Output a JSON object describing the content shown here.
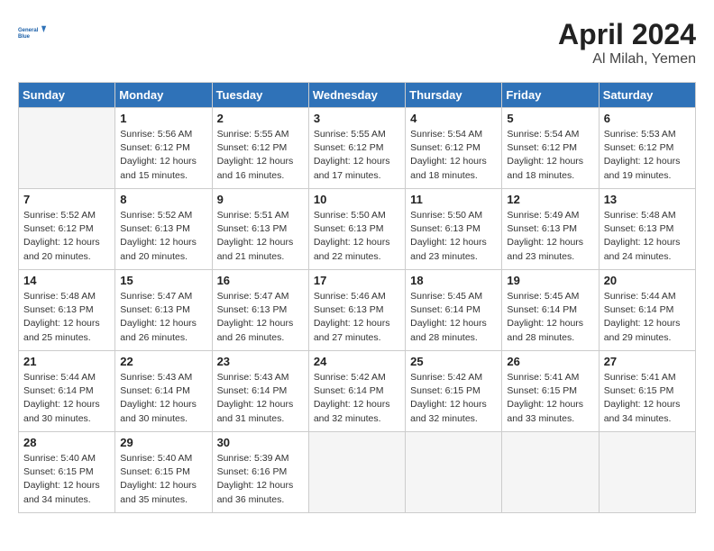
{
  "header": {
    "logo_line1": "General",
    "logo_line2": "Blue",
    "month_year": "April 2024",
    "location": "Al Milah, Yemen"
  },
  "weekdays": [
    "Sunday",
    "Monday",
    "Tuesday",
    "Wednesday",
    "Thursday",
    "Friday",
    "Saturday"
  ],
  "weeks": [
    [
      {
        "day": "",
        "info": ""
      },
      {
        "day": "1",
        "info": "Sunrise: 5:56 AM\nSunset: 6:12 PM\nDaylight: 12 hours\nand 15 minutes."
      },
      {
        "day": "2",
        "info": "Sunrise: 5:55 AM\nSunset: 6:12 PM\nDaylight: 12 hours\nand 16 minutes."
      },
      {
        "day": "3",
        "info": "Sunrise: 5:55 AM\nSunset: 6:12 PM\nDaylight: 12 hours\nand 17 minutes."
      },
      {
        "day": "4",
        "info": "Sunrise: 5:54 AM\nSunset: 6:12 PM\nDaylight: 12 hours\nand 18 minutes."
      },
      {
        "day": "5",
        "info": "Sunrise: 5:54 AM\nSunset: 6:12 PM\nDaylight: 12 hours\nand 18 minutes."
      },
      {
        "day": "6",
        "info": "Sunrise: 5:53 AM\nSunset: 6:12 PM\nDaylight: 12 hours\nand 19 minutes."
      }
    ],
    [
      {
        "day": "7",
        "info": "Sunrise: 5:52 AM\nSunset: 6:12 PM\nDaylight: 12 hours\nand 20 minutes."
      },
      {
        "day": "8",
        "info": "Sunrise: 5:52 AM\nSunset: 6:13 PM\nDaylight: 12 hours\nand 20 minutes."
      },
      {
        "day": "9",
        "info": "Sunrise: 5:51 AM\nSunset: 6:13 PM\nDaylight: 12 hours\nand 21 minutes."
      },
      {
        "day": "10",
        "info": "Sunrise: 5:50 AM\nSunset: 6:13 PM\nDaylight: 12 hours\nand 22 minutes."
      },
      {
        "day": "11",
        "info": "Sunrise: 5:50 AM\nSunset: 6:13 PM\nDaylight: 12 hours\nand 23 minutes."
      },
      {
        "day": "12",
        "info": "Sunrise: 5:49 AM\nSunset: 6:13 PM\nDaylight: 12 hours\nand 23 minutes."
      },
      {
        "day": "13",
        "info": "Sunrise: 5:48 AM\nSunset: 6:13 PM\nDaylight: 12 hours\nand 24 minutes."
      }
    ],
    [
      {
        "day": "14",
        "info": "Sunrise: 5:48 AM\nSunset: 6:13 PM\nDaylight: 12 hours\nand 25 minutes."
      },
      {
        "day": "15",
        "info": "Sunrise: 5:47 AM\nSunset: 6:13 PM\nDaylight: 12 hours\nand 26 minutes."
      },
      {
        "day": "16",
        "info": "Sunrise: 5:47 AM\nSunset: 6:13 PM\nDaylight: 12 hours\nand 26 minutes."
      },
      {
        "day": "17",
        "info": "Sunrise: 5:46 AM\nSunset: 6:13 PM\nDaylight: 12 hours\nand 27 minutes."
      },
      {
        "day": "18",
        "info": "Sunrise: 5:45 AM\nSunset: 6:14 PM\nDaylight: 12 hours\nand 28 minutes."
      },
      {
        "day": "19",
        "info": "Sunrise: 5:45 AM\nSunset: 6:14 PM\nDaylight: 12 hours\nand 28 minutes."
      },
      {
        "day": "20",
        "info": "Sunrise: 5:44 AM\nSunset: 6:14 PM\nDaylight: 12 hours\nand 29 minutes."
      }
    ],
    [
      {
        "day": "21",
        "info": "Sunrise: 5:44 AM\nSunset: 6:14 PM\nDaylight: 12 hours\nand 30 minutes."
      },
      {
        "day": "22",
        "info": "Sunrise: 5:43 AM\nSunset: 6:14 PM\nDaylight: 12 hours\nand 30 minutes."
      },
      {
        "day": "23",
        "info": "Sunrise: 5:43 AM\nSunset: 6:14 PM\nDaylight: 12 hours\nand 31 minutes."
      },
      {
        "day": "24",
        "info": "Sunrise: 5:42 AM\nSunset: 6:14 PM\nDaylight: 12 hours\nand 32 minutes."
      },
      {
        "day": "25",
        "info": "Sunrise: 5:42 AM\nSunset: 6:15 PM\nDaylight: 12 hours\nand 32 minutes."
      },
      {
        "day": "26",
        "info": "Sunrise: 5:41 AM\nSunset: 6:15 PM\nDaylight: 12 hours\nand 33 minutes."
      },
      {
        "day": "27",
        "info": "Sunrise: 5:41 AM\nSunset: 6:15 PM\nDaylight: 12 hours\nand 34 minutes."
      }
    ],
    [
      {
        "day": "28",
        "info": "Sunrise: 5:40 AM\nSunset: 6:15 PM\nDaylight: 12 hours\nand 34 minutes."
      },
      {
        "day": "29",
        "info": "Sunrise: 5:40 AM\nSunset: 6:15 PM\nDaylight: 12 hours\nand 35 minutes."
      },
      {
        "day": "30",
        "info": "Sunrise: 5:39 AM\nSunset: 6:16 PM\nDaylight: 12 hours\nand 36 minutes."
      },
      {
        "day": "",
        "info": ""
      },
      {
        "day": "",
        "info": ""
      },
      {
        "day": "",
        "info": ""
      },
      {
        "day": "",
        "info": ""
      }
    ]
  ]
}
